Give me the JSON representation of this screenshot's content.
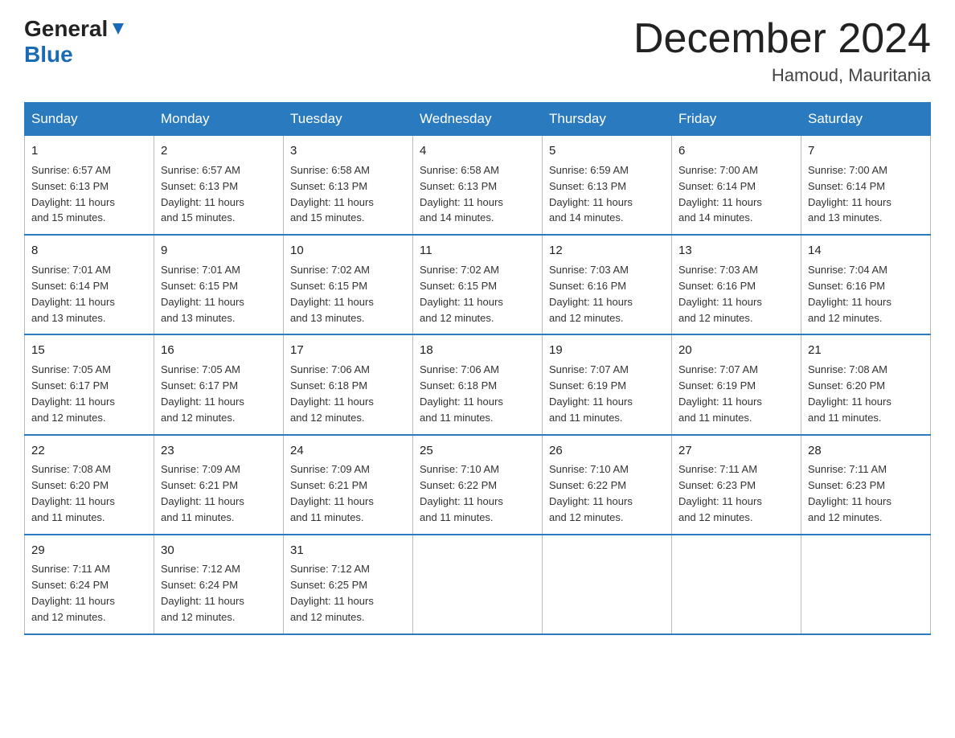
{
  "logo": {
    "general": "General",
    "blue": "Blue",
    "arrow": "▼"
  },
  "title": "December 2024",
  "location": "Hamoud, Mauritania",
  "days_of_week": [
    "Sunday",
    "Monday",
    "Tuesday",
    "Wednesday",
    "Thursday",
    "Friday",
    "Saturday"
  ],
  "weeks": [
    [
      {
        "day": "1",
        "info": "Sunrise: 6:57 AM\nSunset: 6:13 PM\nDaylight: 11 hours\nand 15 minutes."
      },
      {
        "day": "2",
        "info": "Sunrise: 6:57 AM\nSunset: 6:13 PM\nDaylight: 11 hours\nand 15 minutes."
      },
      {
        "day": "3",
        "info": "Sunrise: 6:58 AM\nSunset: 6:13 PM\nDaylight: 11 hours\nand 15 minutes."
      },
      {
        "day": "4",
        "info": "Sunrise: 6:58 AM\nSunset: 6:13 PM\nDaylight: 11 hours\nand 14 minutes."
      },
      {
        "day": "5",
        "info": "Sunrise: 6:59 AM\nSunset: 6:13 PM\nDaylight: 11 hours\nand 14 minutes."
      },
      {
        "day": "6",
        "info": "Sunrise: 7:00 AM\nSunset: 6:14 PM\nDaylight: 11 hours\nand 14 minutes."
      },
      {
        "day": "7",
        "info": "Sunrise: 7:00 AM\nSunset: 6:14 PM\nDaylight: 11 hours\nand 13 minutes."
      }
    ],
    [
      {
        "day": "8",
        "info": "Sunrise: 7:01 AM\nSunset: 6:14 PM\nDaylight: 11 hours\nand 13 minutes."
      },
      {
        "day": "9",
        "info": "Sunrise: 7:01 AM\nSunset: 6:15 PM\nDaylight: 11 hours\nand 13 minutes."
      },
      {
        "day": "10",
        "info": "Sunrise: 7:02 AM\nSunset: 6:15 PM\nDaylight: 11 hours\nand 13 minutes."
      },
      {
        "day": "11",
        "info": "Sunrise: 7:02 AM\nSunset: 6:15 PM\nDaylight: 11 hours\nand 12 minutes."
      },
      {
        "day": "12",
        "info": "Sunrise: 7:03 AM\nSunset: 6:16 PM\nDaylight: 11 hours\nand 12 minutes."
      },
      {
        "day": "13",
        "info": "Sunrise: 7:03 AM\nSunset: 6:16 PM\nDaylight: 11 hours\nand 12 minutes."
      },
      {
        "day": "14",
        "info": "Sunrise: 7:04 AM\nSunset: 6:16 PM\nDaylight: 11 hours\nand 12 minutes."
      }
    ],
    [
      {
        "day": "15",
        "info": "Sunrise: 7:05 AM\nSunset: 6:17 PM\nDaylight: 11 hours\nand 12 minutes."
      },
      {
        "day": "16",
        "info": "Sunrise: 7:05 AM\nSunset: 6:17 PM\nDaylight: 11 hours\nand 12 minutes."
      },
      {
        "day": "17",
        "info": "Sunrise: 7:06 AM\nSunset: 6:18 PM\nDaylight: 11 hours\nand 12 minutes."
      },
      {
        "day": "18",
        "info": "Sunrise: 7:06 AM\nSunset: 6:18 PM\nDaylight: 11 hours\nand 11 minutes."
      },
      {
        "day": "19",
        "info": "Sunrise: 7:07 AM\nSunset: 6:19 PM\nDaylight: 11 hours\nand 11 minutes."
      },
      {
        "day": "20",
        "info": "Sunrise: 7:07 AM\nSunset: 6:19 PM\nDaylight: 11 hours\nand 11 minutes."
      },
      {
        "day": "21",
        "info": "Sunrise: 7:08 AM\nSunset: 6:20 PM\nDaylight: 11 hours\nand 11 minutes."
      }
    ],
    [
      {
        "day": "22",
        "info": "Sunrise: 7:08 AM\nSunset: 6:20 PM\nDaylight: 11 hours\nand 11 minutes."
      },
      {
        "day": "23",
        "info": "Sunrise: 7:09 AM\nSunset: 6:21 PM\nDaylight: 11 hours\nand 11 minutes."
      },
      {
        "day": "24",
        "info": "Sunrise: 7:09 AM\nSunset: 6:21 PM\nDaylight: 11 hours\nand 11 minutes."
      },
      {
        "day": "25",
        "info": "Sunrise: 7:10 AM\nSunset: 6:22 PM\nDaylight: 11 hours\nand 11 minutes."
      },
      {
        "day": "26",
        "info": "Sunrise: 7:10 AM\nSunset: 6:22 PM\nDaylight: 11 hours\nand 12 minutes."
      },
      {
        "day": "27",
        "info": "Sunrise: 7:11 AM\nSunset: 6:23 PM\nDaylight: 11 hours\nand 12 minutes."
      },
      {
        "day": "28",
        "info": "Sunrise: 7:11 AM\nSunset: 6:23 PM\nDaylight: 11 hours\nand 12 minutes."
      }
    ],
    [
      {
        "day": "29",
        "info": "Sunrise: 7:11 AM\nSunset: 6:24 PM\nDaylight: 11 hours\nand 12 minutes."
      },
      {
        "day": "30",
        "info": "Sunrise: 7:12 AM\nSunset: 6:24 PM\nDaylight: 11 hours\nand 12 minutes."
      },
      {
        "day": "31",
        "info": "Sunrise: 7:12 AM\nSunset: 6:25 PM\nDaylight: 11 hours\nand 12 minutes."
      },
      null,
      null,
      null,
      null
    ]
  ]
}
